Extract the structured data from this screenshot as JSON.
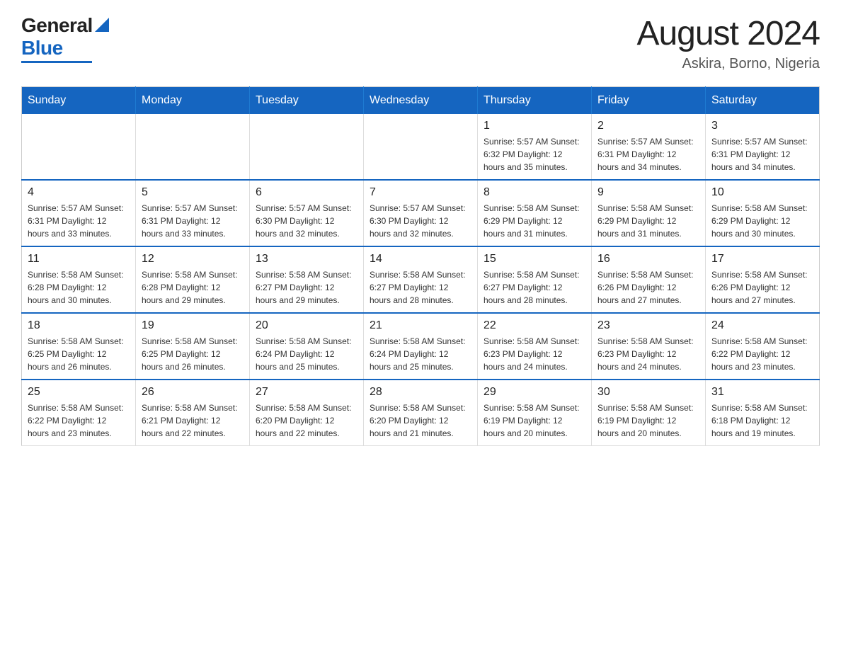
{
  "logo": {
    "general": "General",
    "blue": "Blue",
    "underline_color": "#1565c0"
  },
  "title": "August 2024",
  "location": "Askira, Borno, Nigeria",
  "days_of_week": [
    "Sunday",
    "Monday",
    "Tuesday",
    "Wednesday",
    "Thursday",
    "Friday",
    "Saturday"
  ],
  "weeks": [
    [
      {
        "day": "",
        "info": ""
      },
      {
        "day": "",
        "info": ""
      },
      {
        "day": "",
        "info": ""
      },
      {
        "day": "",
        "info": ""
      },
      {
        "day": "1",
        "info": "Sunrise: 5:57 AM\nSunset: 6:32 PM\nDaylight: 12 hours and 35 minutes."
      },
      {
        "day": "2",
        "info": "Sunrise: 5:57 AM\nSunset: 6:31 PM\nDaylight: 12 hours and 34 minutes."
      },
      {
        "day": "3",
        "info": "Sunrise: 5:57 AM\nSunset: 6:31 PM\nDaylight: 12 hours and 34 minutes."
      }
    ],
    [
      {
        "day": "4",
        "info": "Sunrise: 5:57 AM\nSunset: 6:31 PM\nDaylight: 12 hours and 33 minutes."
      },
      {
        "day": "5",
        "info": "Sunrise: 5:57 AM\nSunset: 6:31 PM\nDaylight: 12 hours and 33 minutes."
      },
      {
        "day": "6",
        "info": "Sunrise: 5:57 AM\nSunset: 6:30 PM\nDaylight: 12 hours and 32 minutes."
      },
      {
        "day": "7",
        "info": "Sunrise: 5:57 AM\nSunset: 6:30 PM\nDaylight: 12 hours and 32 minutes."
      },
      {
        "day": "8",
        "info": "Sunrise: 5:58 AM\nSunset: 6:29 PM\nDaylight: 12 hours and 31 minutes."
      },
      {
        "day": "9",
        "info": "Sunrise: 5:58 AM\nSunset: 6:29 PM\nDaylight: 12 hours and 31 minutes."
      },
      {
        "day": "10",
        "info": "Sunrise: 5:58 AM\nSunset: 6:29 PM\nDaylight: 12 hours and 30 minutes."
      }
    ],
    [
      {
        "day": "11",
        "info": "Sunrise: 5:58 AM\nSunset: 6:28 PM\nDaylight: 12 hours and 30 minutes."
      },
      {
        "day": "12",
        "info": "Sunrise: 5:58 AM\nSunset: 6:28 PM\nDaylight: 12 hours and 29 minutes."
      },
      {
        "day": "13",
        "info": "Sunrise: 5:58 AM\nSunset: 6:27 PM\nDaylight: 12 hours and 29 minutes."
      },
      {
        "day": "14",
        "info": "Sunrise: 5:58 AM\nSunset: 6:27 PM\nDaylight: 12 hours and 28 minutes."
      },
      {
        "day": "15",
        "info": "Sunrise: 5:58 AM\nSunset: 6:27 PM\nDaylight: 12 hours and 28 minutes."
      },
      {
        "day": "16",
        "info": "Sunrise: 5:58 AM\nSunset: 6:26 PM\nDaylight: 12 hours and 27 minutes."
      },
      {
        "day": "17",
        "info": "Sunrise: 5:58 AM\nSunset: 6:26 PM\nDaylight: 12 hours and 27 minutes."
      }
    ],
    [
      {
        "day": "18",
        "info": "Sunrise: 5:58 AM\nSunset: 6:25 PM\nDaylight: 12 hours and 26 minutes."
      },
      {
        "day": "19",
        "info": "Sunrise: 5:58 AM\nSunset: 6:25 PM\nDaylight: 12 hours and 26 minutes."
      },
      {
        "day": "20",
        "info": "Sunrise: 5:58 AM\nSunset: 6:24 PM\nDaylight: 12 hours and 25 minutes."
      },
      {
        "day": "21",
        "info": "Sunrise: 5:58 AM\nSunset: 6:24 PM\nDaylight: 12 hours and 25 minutes."
      },
      {
        "day": "22",
        "info": "Sunrise: 5:58 AM\nSunset: 6:23 PM\nDaylight: 12 hours and 24 minutes."
      },
      {
        "day": "23",
        "info": "Sunrise: 5:58 AM\nSunset: 6:23 PM\nDaylight: 12 hours and 24 minutes."
      },
      {
        "day": "24",
        "info": "Sunrise: 5:58 AM\nSunset: 6:22 PM\nDaylight: 12 hours and 23 minutes."
      }
    ],
    [
      {
        "day": "25",
        "info": "Sunrise: 5:58 AM\nSunset: 6:22 PM\nDaylight: 12 hours and 23 minutes."
      },
      {
        "day": "26",
        "info": "Sunrise: 5:58 AM\nSunset: 6:21 PM\nDaylight: 12 hours and 22 minutes."
      },
      {
        "day": "27",
        "info": "Sunrise: 5:58 AM\nSunset: 6:20 PM\nDaylight: 12 hours and 22 minutes."
      },
      {
        "day": "28",
        "info": "Sunrise: 5:58 AM\nSunset: 6:20 PM\nDaylight: 12 hours and 21 minutes."
      },
      {
        "day": "29",
        "info": "Sunrise: 5:58 AM\nSunset: 6:19 PM\nDaylight: 12 hours and 20 minutes."
      },
      {
        "day": "30",
        "info": "Sunrise: 5:58 AM\nSunset: 6:19 PM\nDaylight: 12 hours and 20 minutes."
      },
      {
        "day": "31",
        "info": "Sunrise: 5:58 AM\nSunset: 6:18 PM\nDaylight: 12 hours and 19 minutes."
      }
    ]
  ]
}
